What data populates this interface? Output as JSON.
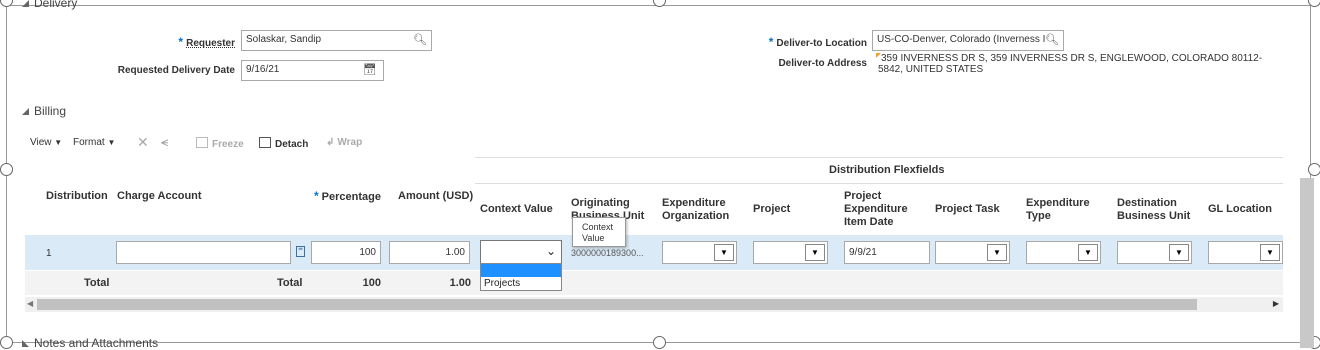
{
  "sections": {
    "delivery": "Delivery",
    "billing": "Billing",
    "notes": "Notes and Attachments"
  },
  "delivery": {
    "requester_label": "Requester",
    "requester_value": "Solaskar, Sandip",
    "requested_date_label": "Requested Delivery Date",
    "requested_date_value": "9/16/21",
    "deliver_to_location_label": "Deliver-to Location",
    "deliver_to_location_value": "US-CO-Denver, Colorado (Inverness I",
    "deliver_to_address_label": "Deliver-to Address",
    "deliver_to_address_line1": "359 INVERNESS DR S, 359 INVERNESS DR S, ENGLEWOOD, COLORADO 80112-",
    "deliver_to_address_line2": "5842, UNITED STATES"
  },
  "toolbar": {
    "view": "View",
    "format": "Format",
    "freeze": "Freeze",
    "detach": "Detach",
    "wrap": "Wrap"
  },
  "table": {
    "group_header": "Distribution Flexfields",
    "headers": {
      "distribution": "Distribution",
      "charge_account": "Charge Account",
      "percentage": "Percentage",
      "amount": "Amount (USD)",
      "context_value": "Context Value",
      "originating_bu_1": "Originating",
      "originating_bu_2": "Business Unit",
      "exp_org_1": "Expenditure",
      "exp_org_2": "Organization",
      "project": "Project",
      "exp_date_1": "Project",
      "exp_date_2": "Expenditure",
      "exp_date_3": "Item Date",
      "project_task": "Project Task",
      "exp_type_1": "Expenditure",
      "exp_type_2": "Type",
      "dest_bu_1": "Destination",
      "dest_bu_2": "Business Unit",
      "gl_location": "GL Location"
    },
    "row": {
      "distribution": "1",
      "percentage": "100",
      "amount": "1.00",
      "originating_bu": "3000000189300...",
      "exp_item_date": "9/9/21"
    },
    "totals": {
      "label1": "Total",
      "label2": "Total",
      "percentage": "100",
      "amount": "1.00"
    },
    "tooltip": {
      "line1": "Context",
      "line2": "Value"
    },
    "dropdown_options": [
      "",
      "Projects"
    ]
  }
}
